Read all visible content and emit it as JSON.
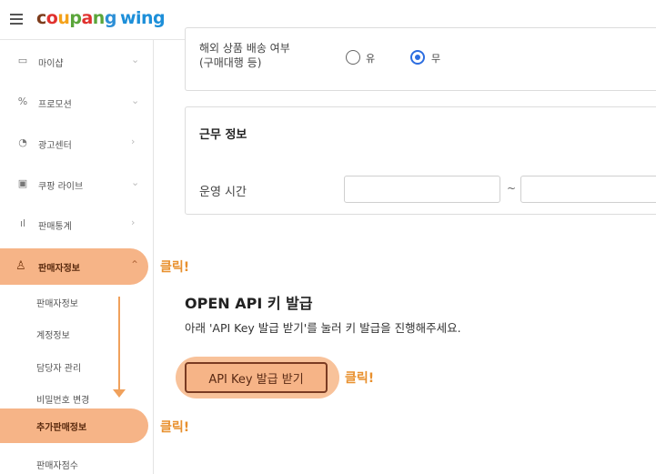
{
  "header": {
    "logo_parts": [
      "c",
      "o",
      "u",
      "p",
      "a",
      "n",
      "g"
    ],
    "logo_wing": "wing"
  },
  "sidebar": {
    "items": [
      {
        "label": "마이샵",
        "icon": "shop-icon"
      },
      {
        "label": "프로모션",
        "icon": "promotion-icon"
      },
      {
        "label": "광고센터",
        "icon": "ad-center-icon"
      },
      {
        "label": "쿠팡 라이브",
        "icon": "live-icon"
      },
      {
        "label": "판매통계",
        "icon": "stats-icon"
      }
    ],
    "active_item": {
      "label": "판매자정보",
      "icon": "user-icon"
    },
    "sub_items": [
      "판매자정보",
      "계정정보",
      "담당자 관리",
      "비밀번호 변경"
    ],
    "active_sub_item": "추가판매정보",
    "more_item": "판매자점수"
  },
  "annotations": {
    "click_1": "클릭!",
    "click_2": "클릭!",
    "click_3": "클릭!"
  },
  "overseas": {
    "label_line1": "해외 상품 배송 여부",
    "label_line2": "(구매대행 등)",
    "option_yes": "유",
    "option_no": "무",
    "selected": "무"
  },
  "work_info": {
    "title": "근무 정보",
    "hours_label": "운영 시간",
    "separator": "~",
    "start_value": "",
    "end_value": ""
  },
  "open_api": {
    "title": "OPEN API 키 발급",
    "description": "아래 'API Key 발급 받기'를 눌러 키 발급을 진행해주세요.",
    "button_label": "API Key 발급 받기"
  },
  "colors": {
    "highlight": "#f6b487",
    "annotation": "#e8902e",
    "radio_selected": "#2c6de0"
  }
}
